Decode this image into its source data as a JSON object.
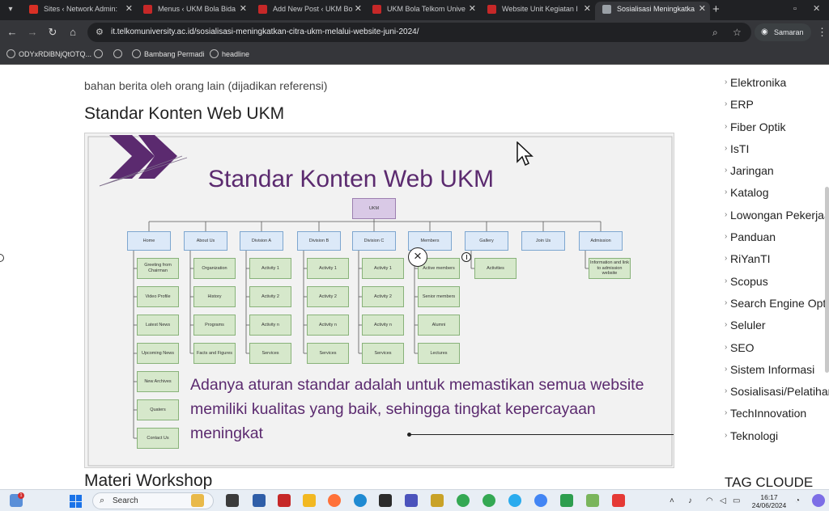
{
  "tabs": [
    {
      "title": "Sites ‹ Network Admin: ",
      "color": "#d93025"
    },
    {
      "title": "Menus ‹ UKM Bola Bida",
      "color": "#c62828"
    },
    {
      "title": "Add New Post ‹ UKM Bo",
      "color": "#c62828"
    },
    {
      "title": "UKM Bola Telkom Unive",
      "color": "#c62828"
    },
    {
      "title": "Website Unit Kegiatan I",
      "color": "#c62828"
    },
    {
      "title": "Sosialisasi Meningkatka",
      "color": "#9aa0a6"
    }
  ],
  "address": {
    "url": "it.telkomuniversity.ac.id/sosialisasi-meningkatkan-citra-ukm-melalui-website-juni-2024/"
  },
  "profile": {
    "name": "Samaran"
  },
  "bookmarks": [
    "ODYxRDlBNjQtOTQ...",
    "",
    "",
    "Bambang Permadi",
    "headline"
  ],
  "article": {
    "intro": "bahan berita oleh orang lain (dijadikan referensi)",
    "heading1": "Standar Konten Web UKM",
    "heading2": "Materi Workshop"
  },
  "slide": {
    "title": "Standar Konten Web UKM",
    "root": "UKM",
    "columns": [
      {
        "label": "Home",
        "items": [
          "Greeting from Chairman",
          "Video Profile",
          "Latest News",
          "Upcoming News",
          "New Archives",
          "Quaters",
          "Contact Us"
        ]
      },
      {
        "label": "About Us",
        "items": [
          "Organization",
          "History",
          "Programs",
          "Facts and Figures"
        ]
      },
      {
        "label": "Division A",
        "items": [
          "Activity 1",
          "Activity 2",
          "Activity n",
          "Services"
        ]
      },
      {
        "label": "Division B",
        "items": [
          "Activity 1",
          "Activity 2",
          "Activity n",
          "Services"
        ]
      },
      {
        "label": "Division C",
        "items": [
          "Activity 1",
          "Activity 2",
          "Activity n",
          "Services"
        ]
      },
      {
        "label": "Members",
        "items": [
          "Active members",
          "Senior members",
          "Alumni",
          "Lectures"
        ]
      },
      {
        "label": "Gallery",
        "items": [
          "Activities"
        ]
      },
      {
        "label": "Join Us",
        "items": []
      },
      {
        "label": "Admission",
        "items": [
          "Information and link to admission website"
        ]
      }
    ],
    "quote": "Adanya aturan standar adalah untuk memastikan semua website memiliki kualitas yang baik, sehingga tingkat kepercayaan meningkat",
    "colors": {
      "purple": "#5b2a6f",
      "node_blue": "#dce9f8",
      "node_green": "#d6e8cb",
      "node_purple": "#d9c9e6"
    }
  },
  "sidebar": {
    "categories": [
      "Elektronika",
      "ERP",
      "Fiber Optik",
      "IsTI",
      "Jaringan",
      "Katalog",
      "Lowongan Pekerjaan",
      "Panduan",
      "RiYanTI",
      "Scopus",
      "Search Engine Optimization",
      "Seluler",
      "SEO",
      "Sistem Informasi",
      "Sosialisasi/Pelatihan",
      "TechInnovation",
      "Teknologi"
    ],
    "tag_heading": "TAG CLOUDE"
  },
  "taskbar": {
    "search_label": "Search",
    "time": "16:17",
    "date": "24/06/2024"
  }
}
